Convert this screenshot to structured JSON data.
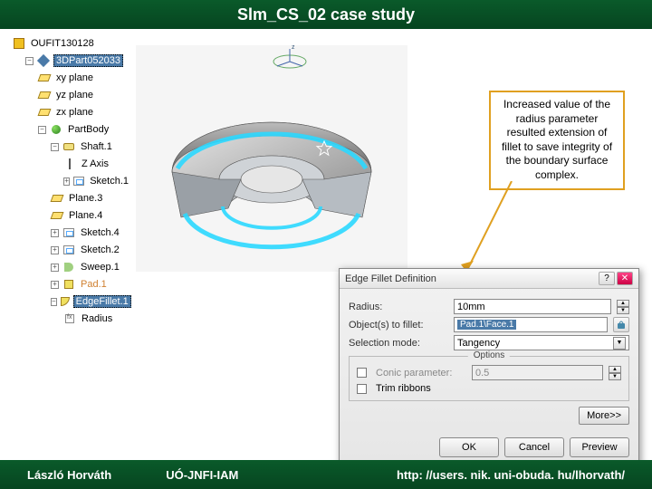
{
  "header": {
    "title": "Slm_CS_02 case study"
  },
  "tree": {
    "root": "OUFIT130128",
    "part": "3DPart052033",
    "items": [
      "xy plane",
      "yz plane",
      "zx plane"
    ],
    "body": "PartBody",
    "shaft": "Shaft.1",
    "axis": "Z Axis",
    "sketch1": "Sketch.1",
    "planes": [
      "Plane.3",
      "Plane.4"
    ],
    "sketches": [
      "Sketch.4",
      "Sketch.2"
    ],
    "sweep": "Sweep.1",
    "pad": "Pad.1",
    "fillet": "EdgeFillet.1",
    "radius": "Radius"
  },
  "callout": {
    "text": "Increased value of the radius parameter resulted extension of fillet to save integrity of the boundary surface complex."
  },
  "dialog": {
    "title": "Edge Fillet Definition",
    "help": "?",
    "close": "✕",
    "radius_label": "Radius:",
    "radius_value": "10mm",
    "objects_label": "Object(s) to fillet:",
    "objects_value": "Pad.1\\Face.1",
    "selmode_label": "Selection mode:",
    "selmode_value": "Tangency",
    "options_title": "Options",
    "conic_label": "Conic parameter:",
    "conic_value": "0.5",
    "trim_label": "Trim ribbons",
    "more": "More>>",
    "ok": "OK",
    "cancel": "Cancel",
    "preview": "Preview"
  },
  "footer": {
    "author": "László Horváth",
    "org": "UÓ-JNFI-IAM",
    "url": "http: //users. nik. uni-obuda. hu/lhorvath/"
  }
}
